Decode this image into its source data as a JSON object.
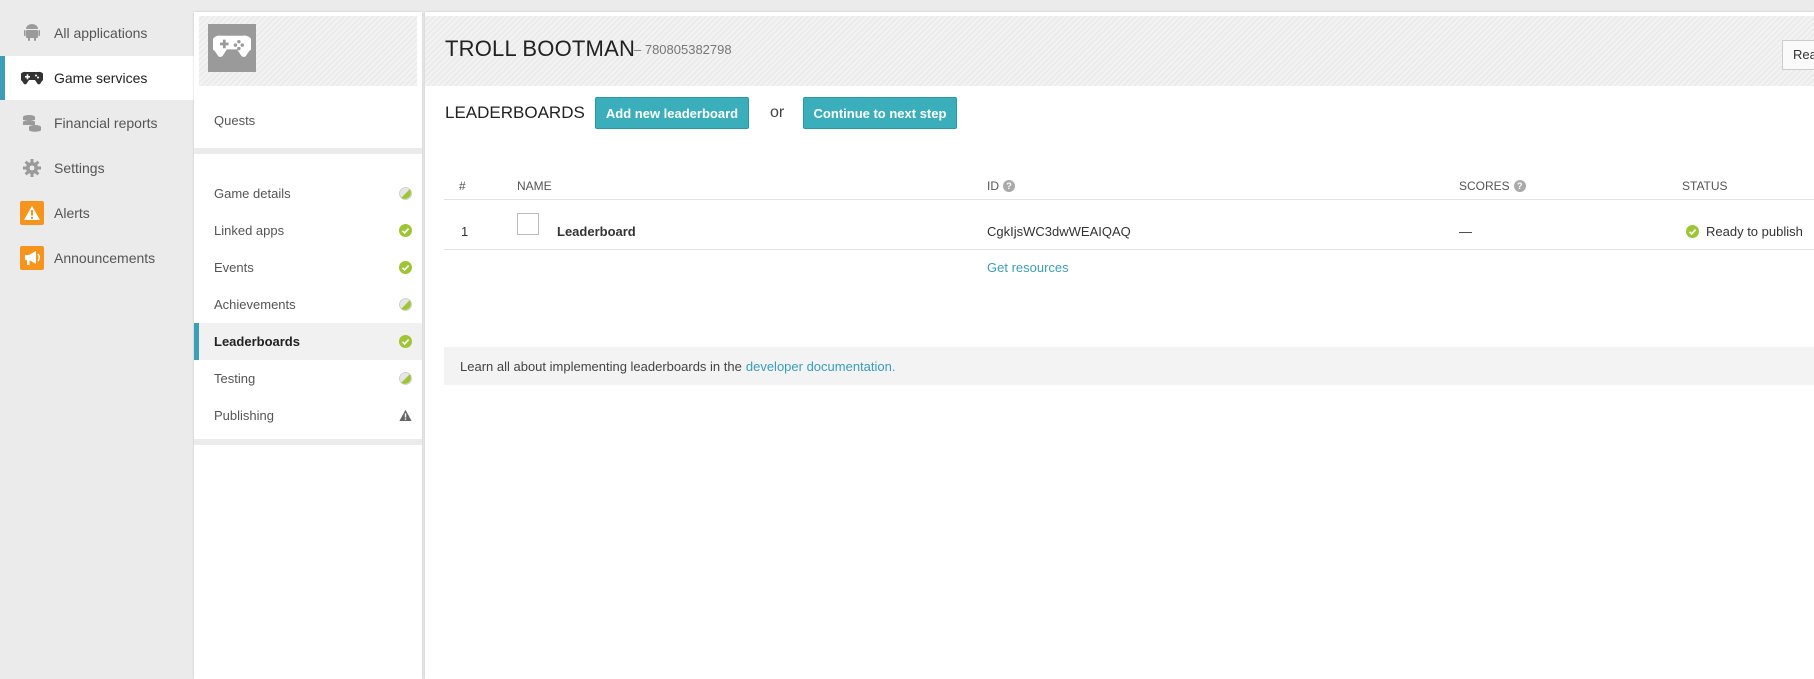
{
  "nav": {
    "items": [
      {
        "label": "All applications",
        "icon": "android-icon"
      },
      {
        "label": "Game services",
        "icon": "gamepad-icon"
      },
      {
        "label": "Financial reports",
        "icon": "coins-icon"
      },
      {
        "label": "Settings",
        "icon": "gear-icon"
      },
      {
        "label": "Alerts",
        "icon": "warning-icon"
      },
      {
        "label": "Announcements",
        "icon": "megaphone-icon"
      }
    ],
    "active_index": 1,
    "accent_color": "#3d9fb7",
    "alert_color": "#f7941d"
  },
  "game_nav": {
    "avatar_icon": "gamepad-icon",
    "quests_label": "Quests",
    "items": [
      {
        "label": "Game details",
        "status": "partial"
      },
      {
        "label": "Linked apps",
        "status": "complete"
      },
      {
        "label": "Events",
        "status": "complete"
      },
      {
        "label": "Achievements",
        "status": "partial"
      },
      {
        "label": "Leaderboards",
        "status": "complete"
      },
      {
        "label": "Testing",
        "status": "partial"
      },
      {
        "label": "Publishing",
        "status": "warning"
      }
    ],
    "active_index": 4,
    "status_color": "#9dc534"
  },
  "header": {
    "title": "TROLL BOOTMAN",
    "app_id": "– 780805382798",
    "corner_button": "Rea"
  },
  "section": {
    "title": "LEADERBOARDS",
    "add_button": "Add new leaderboard",
    "or_text": "or",
    "continue_button": "Continue to next step",
    "button_color": "#3aaeba"
  },
  "table": {
    "columns": {
      "num": "#",
      "name": "NAME",
      "id": "ID",
      "scores": "SCORES",
      "status": "STATUS"
    },
    "rows": [
      {
        "num": "1",
        "name": "Leaderboard",
        "id": "CgkIjsWC3dwWEAIQAQ",
        "scores": "—",
        "status": "Ready to publish"
      }
    ],
    "get_resources": "Get resources"
  },
  "info": {
    "text": "Learn all about implementing leaderboards in the",
    "link": "developer documentation."
  }
}
